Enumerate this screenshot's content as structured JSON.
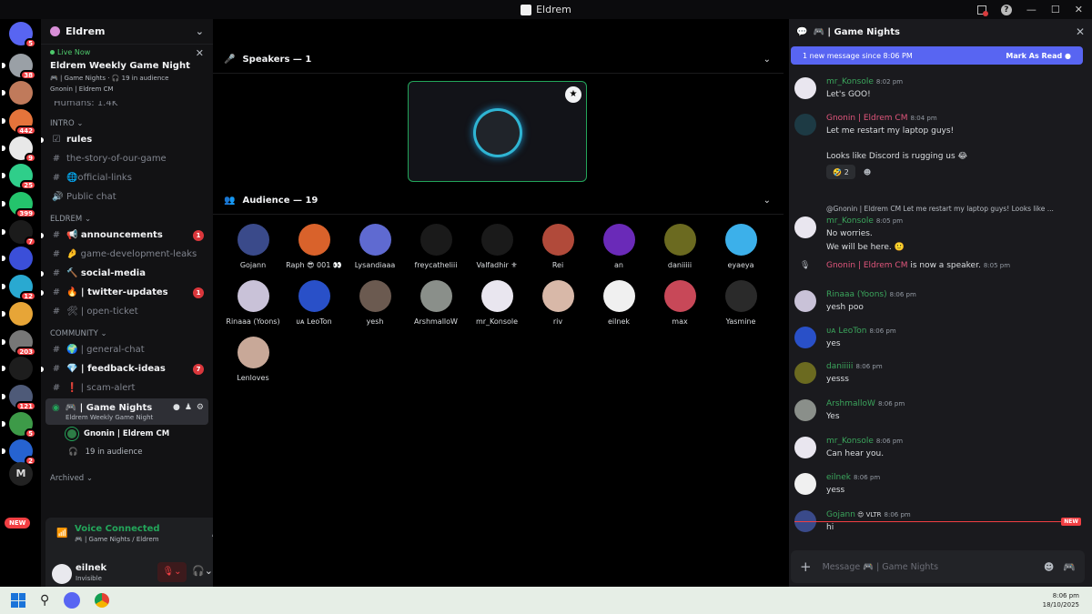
{
  "window": {
    "title": "Eldrem"
  },
  "servers": [
    {
      "badge": "5",
      "color": "#5865f2"
    },
    {
      "badge": "38",
      "color": "#9aa0a6"
    },
    {
      "badge": "",
      "color": "#c07a5b"
    },
    {
      "badge": "442",
      "color": "#e5743b"
    },
    {
      "badge": "9",
      "color": "#e8e8e8"
    },
    {
      "badge": "25",
      "color": "#2fce8a"
    },
    {
      "badge": "399",
      "color": "#24c46c"
    },
    {
      "badge": "7",
      "color": "#1b1b1b"
    },
    {
      "badge": "",
      "color": "#3b4fd9"
    },
    {
      "badge": "12",
      "color": "#29a9d1"
    },
    {
      "badge": "",
      "color": "#e7a537"
    },
    {
      "badge": "203",
      "color": "#777"
    },
    {
      "badge": "",
      "color": "#1d1d1d"
    },
    {
      "badge": "121",
      "color": "#4e5a78"
    },
    {
      "badge": "5",
      "color": "#3d9a48"
    },
    {
      "badge": "2",
      "color": "#2663d0"
    },
    {
      "badge": "",
      "color": "#222"
    }
  ],
  "server_m": "M",
  "new_pill": "NEW",
  "guild": {
    "name": "Eldrem"
  },
  "live": {
    "status": "Live Now",
    "title": "Eldrem Weekly Game Night",
    "sub": "🎮 | Game Nights  ·  🎧 19 in audience",
    "host": "Gnonin | Eldrem CM",
    "close": "✕"
  },
  "humans": "Humans: 1.4K",
  "categories": {
    "intro": "INTRO ⌄",
    "eldrem": "ELDREM ⌄",
    "community": "COMMUNITY ⌄",
    "archived": "Archived ⌄"
  },
  "channels": {
    "rules": {
      "icon": "☑",
      "name": "rules"
    },
    "story": {
      "icon": "#",
      "name": "the-story-of-our-game"
    },
    "links": {
      "icon": "#",
      "name": "🌐official-links"
    },
    "public": {
      "icon": "🔊",
      "name": "Public chat"
    },
    "ann": {
      "icon": "#",
      "name": "📢 announcements",
      "count": "1"
    },
    "leaks": {
      "icon": "#",
      "name": "🤌 game-development-leaks"
    },
    "social": {
      "icon": "#",
      "name": "🔨 social-media"
    },
    "twitter": {
      "icon": "#",
      "name": "🔥 | twitter-updates",
      "count": "1"
    },
    "ticket": {
      "icon": "#",
      "name": "🛠 | open-ticket"
    },
    "general": {
      "icon": "#",
      "name": "🌍 | general-chat"
    },
    "feedback": {
      "icon": "#",
      "name": "💎 | feedback-ideas",
      "count": "7"
    },
    "scam": {
      "icon": "#",
      "name": "❗ | scam-alert"
    }
  },
  "active_channel": {
    "name": "🎮 | Game Nights",
    "sub": "Eldrem Weekly Game Night",
    "speaker": "Gnonin | Eldrem CM",
    "audience": "19 in audience"
  },
  "voice": {
    "status": "Voice Connected",
    "where": "🎮 | Game Nights / Eldrem"
  },
  "user": {
    "name": "eilnek",
    "status": "Invisible"
  },
  "stage": {
    "speakers_label": "Speakers — 1",
    "audience_label": "Audience — 19"
  },
  "audience": [
    {
      "name": "Gojann",
      "color": "#3a4a8a"
    },
    {
      "name": "Raph 😎 001 👀",
      "color": "#d9622b"
    },
    {
      "name": "Lysandiaaa",
      "color": "#5f6ad1"
    },
    {
      "name": "freycatheliii",
      "color": "#1a1a1a"
    },
    {
      "name": "Valfadhir ⚜",
      "color": "#1a1a1a"
    },
    {
      "name": "Rei",
      "color": "#b14a3a"
    },
    {
      "name": "an",
      "color": "#6a2ab8"
    },
    {
      "name": "daniiiii",
      "color": "#6b6a20"
    },
    {
      "name": "eyaeya",
      "color": "#3cb0ea"
    },
    {
      "name": "Rinaaa (Yoons)",
      "color": "#c9c2d8"
    },
    {
      "name": "ᴜᴀ LeoTon",
      "color": "#2950c8"
    },
    {
      "name": "yesh",
      "color": "#6b5a50"
    },
    {
      "name": "ArshmalloW",
      "color": "#8a8f8a"
    },
    {
      "name": "mr_Konsole",
      "color": "#e9e6ef"
    },
    {
      "name": "riv",
      "color": "#d8b8a8"
    },
    {
      "name": "eilnek",
      "color": "#f0f0f0"
    },
    {
      "name": "max",
      "color": "#c84858"
    },
    {
      "name": "Yasmine",
      "color": "#2a2a2a"
    },
    {
      "name": "Lenloves",
      "color": "#c8a898"
    }
  ],
  "chat": {
    "title": "🎮 | Game Nights",
    "new_bar": "1 new message since 8:06 PM",
    "mark_read": "Mark As Read",
    "new_tag": "NEW",
    "placeholder": "Message 🎮 | Game Nights",
    "messages": [
      {
        "author": "mr_Konsole",
        "time": "8:02 pm",
        "lines": [
          "Let's GOO!"
        ],
        "color": "#e9e6ef"
      },
      {
        "author": "Gnonin | Eldrem CM",
        "time": "8:04 pm",
        "lines": [
          "Let me restart my laptop guys!",
          "Looks like Discord is rugging us 😂"
        ],
        "reaction": "🤣 2",
        "color": "#1d3a44"
      },
      {
        "author": "mr_Konsole",
        "time": "8:05 pm",
        "reply": "@Gnonin | Eldrem CM  Let me restart my laptop guys!   Looks like ...",
        "lines": [
          "No worries.",
          "We will be here. 🙂"
        ],
        "color": "#e9e6ef"
      },
      {
        "system_author": "Gnonin | Eldrem CM",
        "system_text": "is now a speaker.",
        "time": "8:05 pm"
      },
      {
        "author": "Rinaaa (Yoons)",
        "time": "8:06 pm",
        "lines": [
          "yesh poo"
        ],
        "color": "#c9c2d8"
      },
      {
        "author": "ᴜᴀ LeoTon",
        "time": "8:06 pm",
        "lines": [
          "yes"
        ],
        "color": "#2950c8"
      },
      {
        "author": "daniiiii",
        "time": "8:06 pm",
        "lines": [
          "yesss"
        ],
        "color": "#6b6a20"
      },
      {
        "author": "ArshmalloW",
        "time": "8:06 pm",
        "lines": [
          "Yes"
        ],
        "color": "#8a8f8a"
      },
      {
        "author": "mr_Konsole",
        "time": "8:06 pm",
        "lines": [
          "Can hear you."
        ],
        "color": "#e9e6ef"
      },
      {
        "author": "eilnek",
        "time": "8:06 pm",
        "lines": [
          "yess"
        ],
        "color": "#f0f0f0"
      },
      {
        "author": "Gojann",
        "tag": "😍 VLTR",
        "time": "8:06 pm",
        "lines": [
          "hi"
        ],
        "color": "#3a4a8a"
      }
    ]
  },
  "clock": {
    "time": "8:06 pm",
    "date": "18/10/2025"
  }
}
